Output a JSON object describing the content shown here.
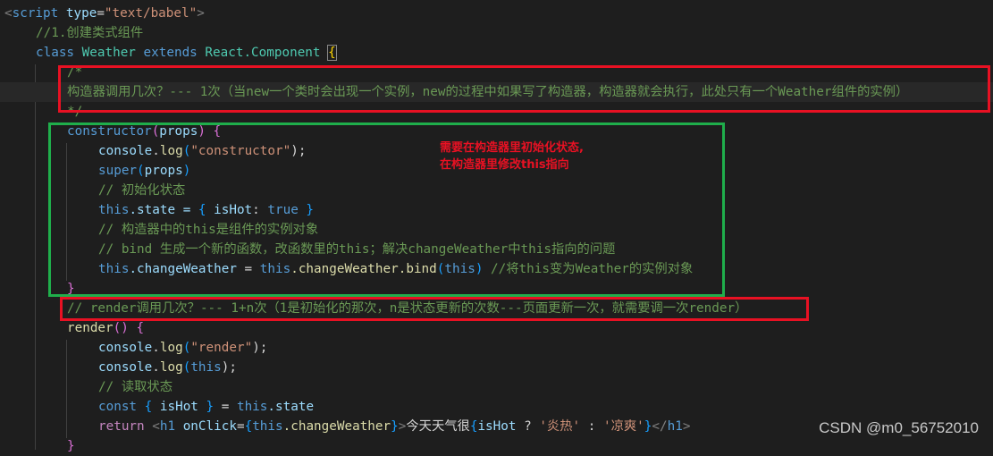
{
  "code": {
    "l1": {
      "open": "<",
      "tag": "script",
      "attr": "type",
      "eq": "=",
      "val": "\"text/babel\"",
      "close": ">"
    },
    "l2": {
      "comment": "//1.创建类式组件"
    },
    "l3": {
      "kw_class": "class",
      "name": "Weather",
      "kw_extends": "extends",
      "base": "React.Component",
      "brace": "{"
    },
    "l4": {
      "comment": "/*"
    },
    "l5": {
      "comment": "构造器调用几次？--- 1次（当new一个类时会出现一个实例，new的过程中如果写了构造器，构造器就会执行，此处只有一个Weather组件的实例）"
    },
    "l6": {
      "comment": "*/"
    },
    "l7": {
      "fn": "constructor",
      "p1": "(",
      "arg": "props",
      "p2": ")",
      "brace": " {"
    },
    "l8": {
      "obj": "console",
      "dot": ".",
      "fn": "log",
      "p1": "(",
      "str": "\"constructor\"",
      "p2": ");"
    },
    "l9": {
      "fn": "super",
      "p1": "(",
      "arg": "props",
      "p2": ")"
    },
    "l10": {
      "comment": "// 初始化状态"
    },
    "l11": {
      "kw_this": "this",
      "rest": ".state = ",
      "b1": "{",
      "key": " isHot",
      "colon": ": ",
      "val": "true",
      "b2": " }"
    },
    "l12": {
      "comment": "// 构造器中的this是组件的实例对象"
    },
    "l13": {
      "comment": "// bind 生成一个新的函数，改函数里的this；解决changeWeather中this指向的问题"
    },
    "l14": {
      "kw_this1": "this",
      "m1": ".changeWeather",
      "eq": " = ",
      "kw_this2": "this",
      "m2": ".changeWeather",
      "m3": ".bind",
      "p1": "(",
      "kw_this3": "this",
      "p2": ")",
      "comment": " //将this变为Weather的实例对象"
    },
    "l15": {
      "brace": "}"
    },
    "l16": {
      "comment": "// render调用几次？--- 1+n次（1是初始化的那次，n是状态更新的次数---页面更新一次，就需要调一次render）"
    },
    "l17": {
      "fn": "render",
      "p": "()",
      "brace": " {"
    },
    "l18": {
      "obj": "console",
      "dot": ".",
      "fn": "log",
      "p1": "(",
      "str": "\"render\"",
      "p2": ");"
    },
    "l19": {
      "obj": "console",
      "dot": ".",
      "fn": "log",
      "p1": "(",
      "kw_this": "this",
      "p2": ");"
    },
    "l20": {
      "comment": "// 读取状态"
    },
    "l21": {
      "kw_const": "const",
      "b1": " {",
      "var": " isHot",
      "b2": " }",
      "eq": " = ",
      "kw_this": "this",
      "rest": ".state"
    },
    "l22": {
      "kw_return": "return",
      "lt": " <",
      "tag": "h1",
      "attr": " onClick",
      "eq": "=",
      "b1": "{",
      "kw_this": "this",
      "member": ".changeWeather",
      "b2": "}",
      "gt": ">",
      "text": "今天天气很",
      "b3": "{",
      "var": "isHot",
      "q": " ? ",
      "s1": "'炎热'",
      "c": " : ",
      "s2": "'凉爽'",
      "b4": "}",
      "closetag_lt": "</",
      "closetag": "h1",
      "closetag_gt": ">"
    },
    "l23": {
      "brace": "}"
    }
  },
  "annotation": {
    "line1": "需要在构造器里初始化状态,",
    "line2": "在构造器里修改this指向"
  },
  "watermark": "CSDN @m0_56752010",
  "colors": {
    "annotation_red": "#e81123",
    "annotation_green": "#1fae4b",
    "background": "#1e1e1e"
  }
}
